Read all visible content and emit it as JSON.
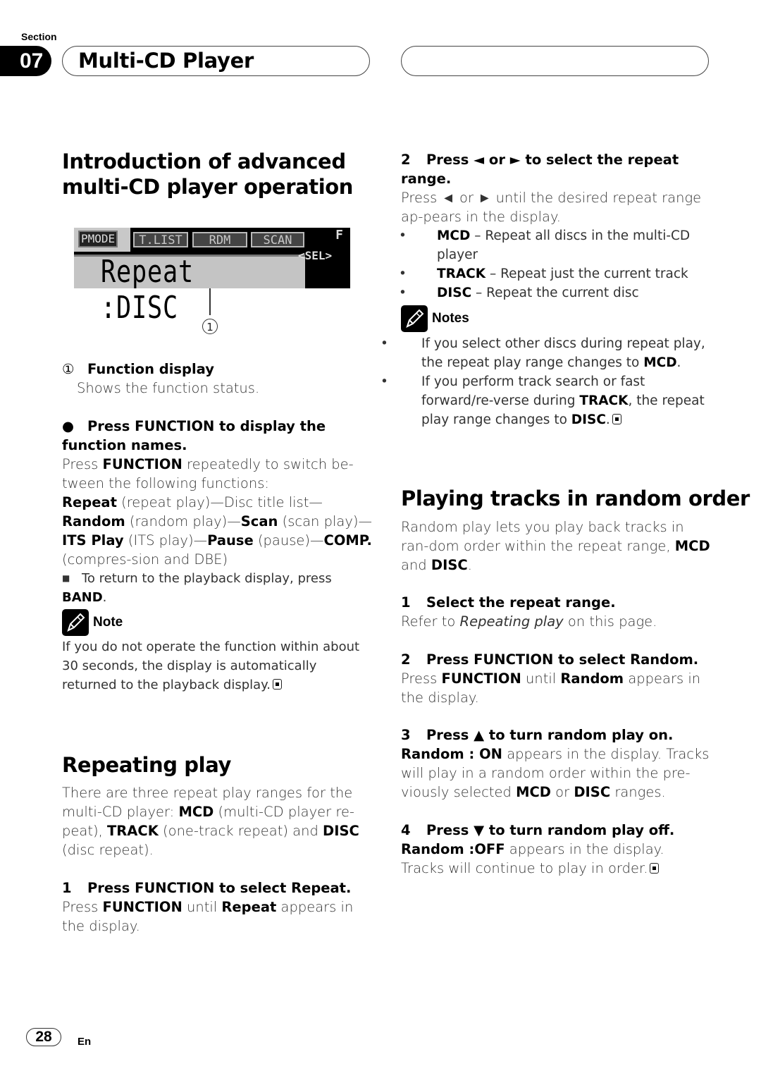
{
  "header": {
    "section_label": "Section",
    "section_number": "07",
    "chapter_title": "Multi-CD Player"
  },
  "intro": {
    "heading_line1": "Introduction of advanced",
    "heading_line2": "multi-CD player operation",
    "lcd": {
      "pmode": "PMODE",
      "tabs": [
        "T.LIST",
        "RDM",
        "SCAN"
      ],
      "f_indicator": "F",
      "sel": "<SEL>",
      "main_text": "Repeat :DISC"
    },
    "callout_number": "1",
    "legend_marker": "①",
    "legend_title": "Function display",
    "legend_desc": "Shows the function status.",
    "step_bullet": "●",
    "step_heading": "Press FUNCTION to display the function names.",
    "para_parts": {
      "press": "Press ",
      "function": "FUNCTION",
      "rest1": " repeatedly to switch be-tween the following functions:",
      "repeat": "Repeat",
      "t1": " (repeat play)—Disc title list—",
      "random": "Random",
      "t2": " (random play)—",
      "scan": "Scan",
      "t3": " (scan play)—",
      "its": "ITS Play",
      "t4": " (ITS play)—",
      "pause": "Pause",
      "t5": " (pause)—",
      "comp": "COMP.",
      "t6": " (compres-sion and DBE)"
    },
    "sub_note_text": "To return to the playback display, press ",
    "sub_note_key": "BAND",
    "note_label": "Note",
    "note_text": "If you do not operate the function within about 30 seconds, the display is automatically returned to the playback display."
  },
  "repeating": {
    "heading": "Repeating play",
    "intro": {
      "a": "There are three repeat play ranges for the multi-CD player: ",
      "mcd": "MCD",
      "b": " (multi-CD player re-peat), ",
      "track": "TRACK",
      "c": " (one-track repeat) and ",
      "disc": "DISC",
      "d": " (disc repeat)."
    },
    "step1": {
      "num": "1",
      "heading": "Press FUNCTION to select Repeat.",
      "a": "Press ",
      "function": "FUNCTION",
      "b": " until ",
      "repeat": "Repeat",
      "c": " appears in the display."
    },
    "step2": {
      "num": "2",
      "heading": "Press ◄ or ► to select the repeat range.",
      "body": "Press ◄ or ► until the desired repeat range ap-pears in the display.",
      "options": [
        {
          "key": "MCD",
          "desc": " – Repeat all discs in the multi-CD player"
        },
        {
          "key": "TRACK",
          "desc": " – Repeat just the current track"
        },
        {
          "key": "DISC",
          "desc": " – Repeat the current disc"
        }
      ]
    },
    "notes_label": "Notes",
    "notes": [
      {
        "text": "If you select other discs during repeat play, the repeat play range changes to ",
        "key": "MCD",
        "tail": "."
      },
      {
        "text_a": "If you perform track search or fast forward/re-verse during ",
        "key1": "TRACK",
        "text_b": ", the repeat play range changes to ",
        "key2": "DISC",
        "tail": "."
      }
    ]
  },
  "random": {
    "heading": "Playing tracks in random order",
    "intro": {
      "a": "Random play lets you play back tracks in ran-dom order within the repeat range, ",
      "mcd": "MCD",
      "b": " and ",
      "disc": "DISC",
      "c": "."
    },
    "step1": {
      "num": "1",
      "heading": "Select the repeat range.",
      "a": "Refer to ",
      "ref": "Repeating play",
      "b": " on this page."
    },
    "step2": {
      "num": "2",
      "heading": "Press FUNCTION to select Random.",
      "a": "Press ",
      "function": "FUNCTION",
      "b": " until ",
      "random": "Random",
      "c": " appears in the display."
    },
    "step3": {
      "num": "3",
      "heading": "Press ▲ to turn random play on.",
      "status": "Random : ON",
      "a": " appears in the display. Tracks will play in a random order within the pre-viously selected ",
      "mcd": "MCD",
      "b": " or ",
      "disc": "DISC",
      "c": " ranges."
    },
    "step4": {
      "num": "4",
      "heading": "Press ▼ to turn random play off.",
      "status": "Random :OFF",
      "a": " appears in the display. Tracks will continue to play in order."
    }
  },
  "footer": {
    "page_number": "28",
    "language": "En"
  }
}
